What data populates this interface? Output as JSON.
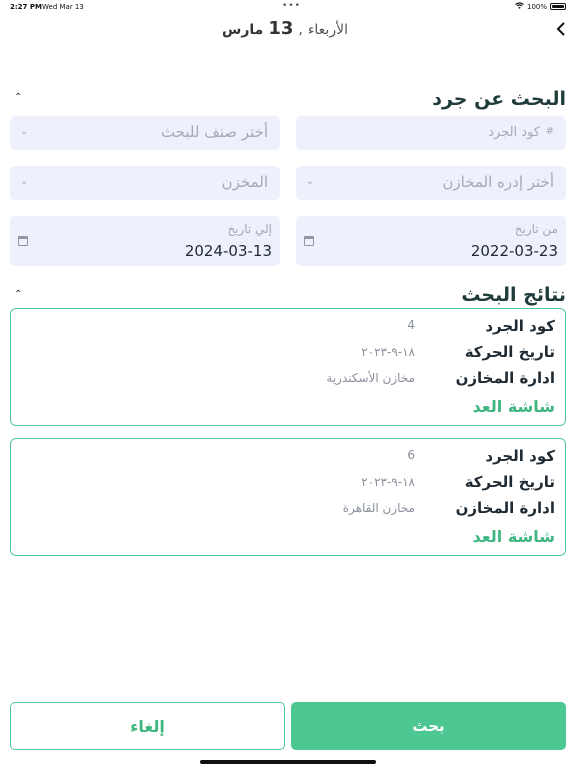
{
  "status_bar": {
    "time": "2:27 PM",
    "date": "Wed Mar 13",
    "battery": "100%"
  },
  "header": {
    "back_icon": "chevron-left-icon",
    "weekday": "الأربعاء",
    "separator": ",",
    "day": "13",
    "month": "مارس"
  },
  "search_section": {
    "title": "البحث عن جرد",
    "fields": {
      "inventory_code_placeholder": "كود الجرد",
      "category_placeholder": "أختر صنف للبحث",
      "warehouse_admin_placeholder": "أختر إدره المخازن",
      "warehouse_placeholder": "المخزن",
      "from_date_label": "من تاريخ",
      "from_date_value": "2022-03-23",
      "to_date_label": "إلي تاريخ",
      "to_date_value": "2024-03-13"
    }
  },
  "results_section": {
    "title": "نتائج البحث",
    "labels": {
      "code": "كود الجرد",
      "movement_date": "تاريخ الحركة",
      "warehouse_admin": "ادارة المخازن",
      "counter_link": "شاشة العد"
    },
    "results": [
      {
        "code": "4",
        "movement_date": "١٨-٩-٢٠٢٣",
        "warehouse_admin": "مخازن الأسكندرية"
      },
      {
        "code": "6",
        "movement_date": "١٨-٩-٢٠٢٣",
        "warehouse_admin": "مخازن القاهرة"
      }
    ]
  },
  "actions": {
    "cancel_label": "إلغاء",
    "search_label": "بحث"
  },
  "colors": {
    "accent": "#4cc791",
    "field_bg": "#eef1fb",
    "placeholder": "#a3a9b8"
  }
}
